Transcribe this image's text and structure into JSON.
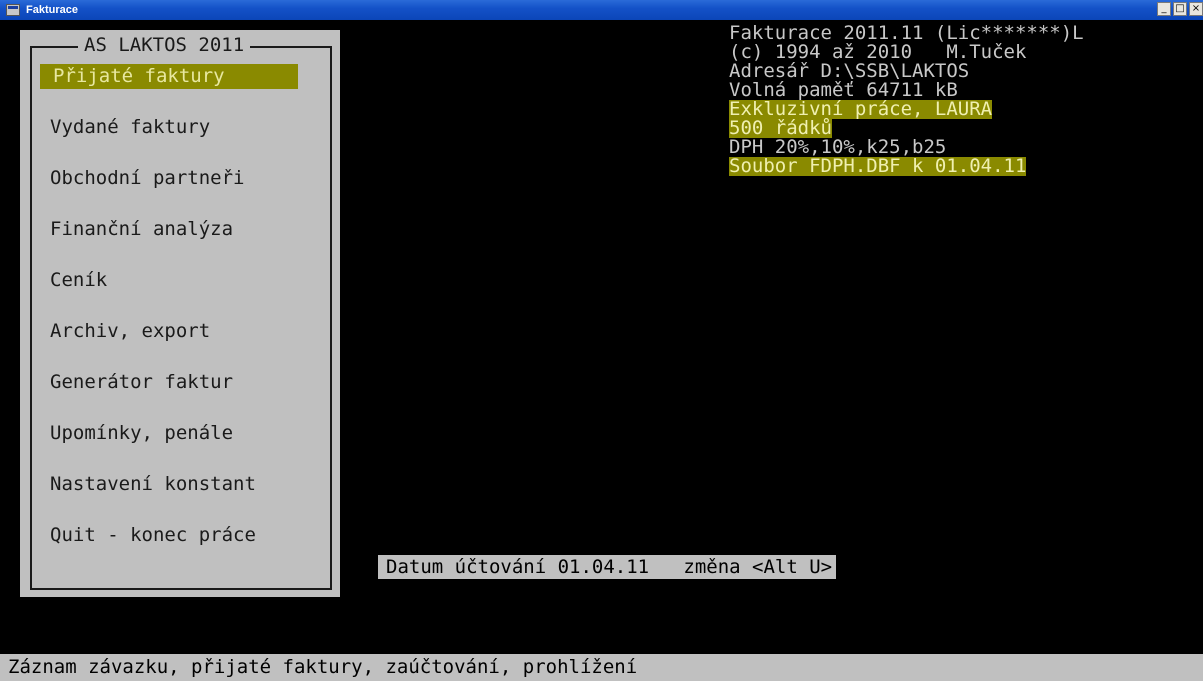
{
  "window": {
    "title": "Fakturace",
    "controls": [
      "_",
      "□",
      "×"
    ]
  },
  "menu": {
    "title": "AS LAKTOS 2011",
    "items": [
      {
        "label": "Přijaté faktury",
        "selected": true
      },
      {
        "label": "Vydané faktury",
        "selected": false
      },
      {
        "label": "Obchodní partneři",
        "selected": false
      },
      {
        "label": "Finanční analýza",
        "selected": false
      },
      {
        "label": "Ceník",
        "selected": false
      },
      {
        "label": "Archiv, export",
        "selected": false
      },
      {
        "label": "Generátor faktur",
        "selected": false
      },
      {
        "label": "Upomínky, penále",
        "selected": false
      },
      {
        "label": "Nastavení konstant",
        "selected": false
      },
      {
        "label": "Quit - konec práce",
        "selected": false
      }
    ]
  },
  "info": {
    "version": "Fakturace 2011.11 (Lic*******)L",
    "copyright": "(c) 1994 až 2010   M.Tuček",
    "directory": "Adresář D:\\SSB\\LAKTOS",
    "memory": "Volná paměť 64711 kB",
    "license_holder": "Exkluzivní práce, LAURA",
    "rows": "500 řádků",
    "vat": "DPH 20%,10%,k25,b25",
    "vat_file": "Soubor FDPH.DBF k 01.04.11"
  },
  "accounting_date": "Datum účtování 01.04.11   změna <Alt U>",
  "status": "Záznam závazku, přijaté faktury, zaúčtování, prohlížení",
  "colors": {
    "menu_bg": "#c0c0c0",
    "highlight_bg": "#8a8a00",
    "terminal_bg": "#000000",
    "titlebar": "#0b46b8"
  }
}
